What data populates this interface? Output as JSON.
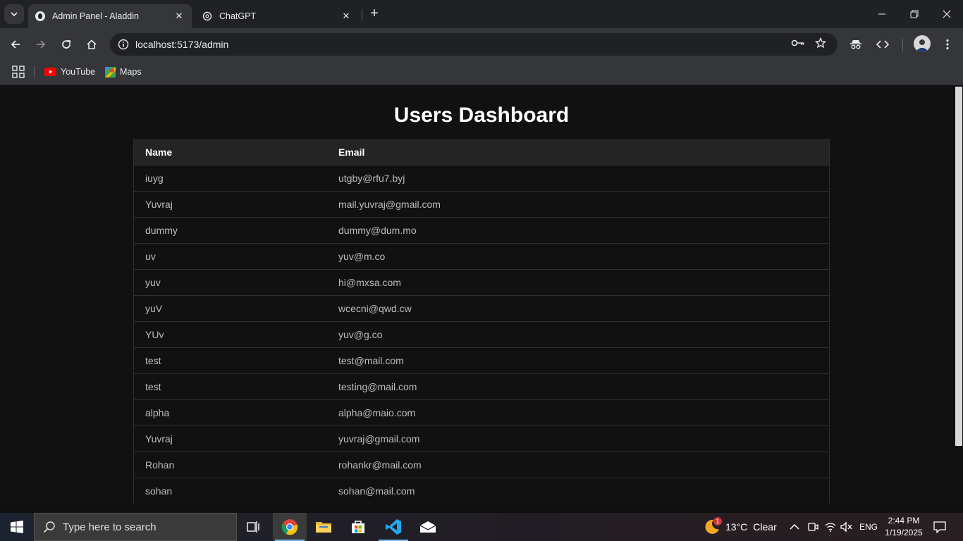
{
  "browser": {
    "tabs": [
      {
        "title": "Admin Panel - Aladdin",
        "active": true
      },
      {
        "title": "ChatGPT",
        "active": false
      }
    ],
    "url": "localhost:5173/admin",
    "bookmarks": [
      {
        "label": "YouTube",
        "icon": "youtube-icon"
      },
      {
        "label": "Maps",
        "icon": "maps-icon"
      }
    ]
  },
  "page": {
    "title": "Users Dashboard",
    "table": {
      "headers": {
        "name": "Name",
        "email": "Email"
      },
      "rows": [
        {
          "name": "iuyg",
          "email": "utgby@rfu7.byj"
        },
        {
          "name": "Yuvraj",
          "email": "mail.yuvraj@gmail.com"
        },
        {
          "name": "dummy",
          "email": "dummy@dum.mo"
        },
        {
          "name": "uv",
          "email": "yuv@m.co"
        },
        {
          "name": "yuv",
          "email": "hi@mxsa.com"
        },
        {
          "name": "yuV",
          "email": "wcecni@qwd.cw"
        },
        {
          "name": "YUv",
          "email": "yuv@g.co"
        },
        {
          "name": "test",
          "email": "test@mail.com"
        },
        {
          "name": "test",
          "email": "testing@mail.com"
        },
        {
          "name": "alpha",
          "email": "alpha@maio.com"
        },
        {
          "name": "Yuvraj",
          "email": "yuvraj@gmail.com"
        },
        {
          "name": "Rohan",
          "email": "rohankr@mail.com"
        },
        {
          "name": "sohan",
          "email": "sohan@mail.com"
        }
      ]
    }
  },
  "taskbar": {
    "search_placeholder": "Type here to search",
    "weather": {
      "temp": "13°C",
      "condition": "Clear",
      "badge": "1"
    },
    "language": "ENG",
    "time": "2:44 PM",
    "date": "1/19/2025"
  },
  "colors": {
    "page_bg": "#111111",
    "header_bg": "#242424",
    "browser_bg": "#35363a"
  }
}
